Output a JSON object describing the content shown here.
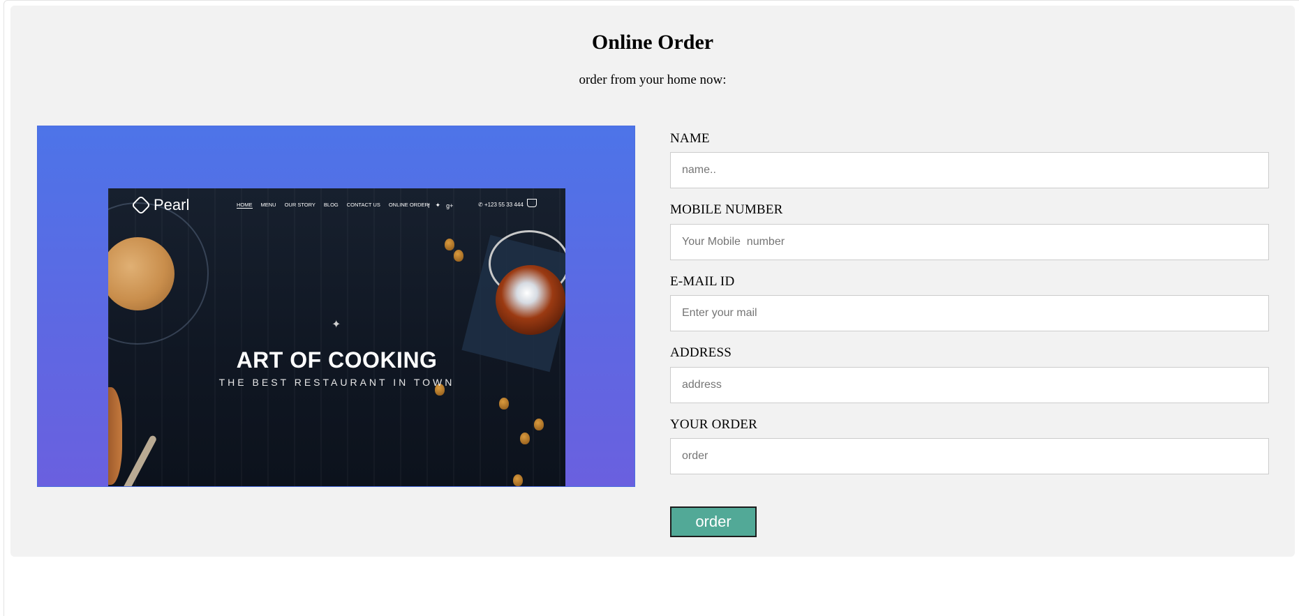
{
  "page": {
    "title": "Online Order",
    "subtitle": "order from your home now:"
  },
  "hero": {
    "logo_text": "Pearl",
    "menu": [
      "HOME",
      "MENU",
      "OUR STORY",
      "BLOG",
      "CONTACT US",
      "ONLINE ORDER"
    ],
    "social_icons": [
      "facebook-icon",
      "twitter-icon",
      "googleplus-icon"
    ],
    "phone": "+123 55 33 444",
    "cart_icon": "cart-icon",
    "cart_count": "0",
    "headline": "ART OF COOKING",
    "tagline": "THE BEST RESTAURANT IN TOWN",
    "colors": {
      "gradient_top": "#4d74e8",
      "gradient_bottom": "#6a60df"
    }
  },
  "form": {
    "fields": [
      {
        "label": "NAME",
        "placeholder": "name..",
        "value": ""
      },
      {
        "label": "MOBILE NUMBER",
        "placeholder": "Your Mobile  number",
        "value": ""
      },
      {
        "label": "E-MAIL ID",
        "placeholder": "Enter your mail",
        "value": ""
      },
      {
        "label": "ADDRESS",
        "placeholder": "address",
        "value": ""
      },
      {
        "label": "YOUR ORDER",
        "placeholder": "order",
        "value": ""
      }
    ],
    "submit_label": "order",
    "colors": {
      "button_bg": "#52a997",
      "button_text": "#ffffff",
      "panel_bg": "#f2f2f2"
    }
  }
}
